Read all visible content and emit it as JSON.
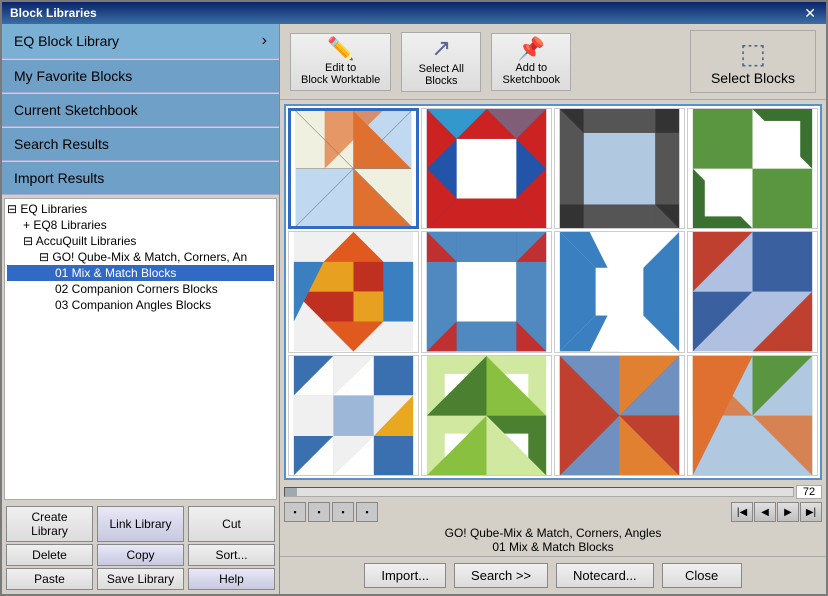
{
  "window": {
    "title": "Block Libraries",
    "close_label": "✕"
  },
  "left_nav": {
    "items": [
      {
        "id": "eq-block-library",
        "label": "EQ Block Library",
        "has_arrow": true
      },
      {
        "id": "my-favorite-blocks",
        "label": "My Favorite Blocks"
      },
      {
        "id": "current-sketchbook",
        "label": "Current Sketchbook"
      },
      {
        "id": "search-results",
        "label": "Search Results"
      },
      {
        "id": "import-results",
        "label": "Import Results"
      }
    ]
  },
  "tree": {
    "items": [
      {
        "id": "eq-libraries",
        "label": "EQ Libraries",
        "indent": 0,
        "prefix": "⊟ "
      },
      {
        "id": "eq8-libraries",
        "label": "EQ8 Libraries",
        "indent": 1,
        "prefix": "+ "
      },
      {
        "id": "accuquilt-libraries",
        "label": "AccuQuilt Libraries",
        "indent": 1,
        "prefix": "⊟ "
      },
      {
        "id": "go-qube",
        "label": "GO! Qube-Mix & Match, Corners, An",
        "indent": 2,
        "prefix": "⊟ "
      },
      {
        "id": "mix-match-blocks",
        "label": "01 Mix & Match Blocks",
        "indent": 3,
        "selected": true
      },
      {
        "id": "companion-corners",
        "label": "02 Companion Corners Blocks",
        "indent": 3
      },
      {
        "id": "companion-angles",
        "label": "03 Companion Angles Blocks",
        "indent": 3
      }
    ]
  },
  "left_buttons": [
    {
      "id": "create-library",
      "label": "Create Library"
    },
    {
      "id": "link-library",
      "label": "Link Library",
      "primary": true
    },
    {
      "id": "cut",
      "label": "Cut"
    },
    {
      "id": "delete",
      "label": "Delete"
    },
    {
      "id": "copy",
      "label": "Copy",
      "primary": true
    },
    {
      "id": "sort",
      "label": "Sort..."
    },
    {
      "id": "paste",
      "label": "Paste"
    },
    {
      "id": "save-library",
      "label": "Save Library"
    },
    {
      "id": "help",
      "label": "Help",
      "primary": true
    }
  ],
  "toolbar": {
    "buttons": [
      {
        "id": "edit-to-block-worktable",
        "label": "Edit to\nBlock Worktable",
        "icon": "✏️"
      },
      {
        "id": "select-all-blocks",
        "label": "Select All\nBlocks",
        "icon": "↗"
      },
      {
        "id": "add-to-sketchbook",
        "label": "Add to\nSketchbook",
        "icon": "📌"
      }
    ],
    "select_blocks_label": "Select Blocks"
  },
  "grid": {
    "page_number": "72",
    "view_buttons": [
      "▪",
      "▪",
      "▪",
      "▪"
    ],
    "page_nav_buttons": [
      "|◀",
      "◀",
      "▶",
      "▶|"
    ]
  },
  "info": {
    "line1": "GO! Qube-Mix & Match, Corners, Angles",
    "line2": "01 Mix & Match Blocks"
  },
  "bottom_buttons": [
    {
      "id": "import",
      "label": "Import..."
    },
    {
      "id": "search",
      "label": "Search  >>"
    },
    {
      "id": "notecard",
      "label": "Notecard..."
    },
    {
      "id": "close",
      "label": "Close"
    }
  ]
}
